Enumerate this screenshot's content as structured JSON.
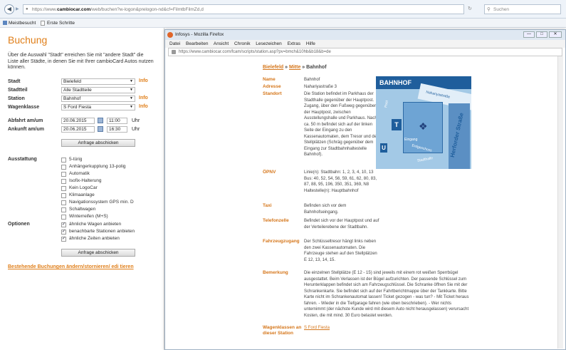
{
  "browser": {
    "url_prefix": "https://www.",
    "url_domain": "cambiocar.com",
    "url_rest": "/web/buchen?w-logon&prelogon-nd&cf=FilmtbFilmZd,d",
    "search_placeholder": "Suchen",
    "bookmarks": [
      "Meistbesucht",
      "Erste Schritte"
    ]
  },
  "booking": {
    "title": "Buchung",
    "intro": "Über die Auswahl \"Stadt\" erreichen Sie mit \"andere Stadt\" die Liste aller Städte, in denen Sie mit Ihrer cambioCard Autos nutzen können.",
    "stadt_label": "Stadt",
    "stadt_value": "Bielefeld",
    "stadtteil_label": "Stadtteil",
    "stadtteil_value": "Alle Stadtteile",
    "station_label": "Station",
    "station_value": "Bahnhof",
    "wagenklasse_label": "Wagenklasse",
    "wagenklasse_value": "S Ford Fiesta",
    "info_label": "Info",
    "abfahrt_label": "Abfahrt am/um",
    "abfahrt_date": "20.06.2015",
    "abfahrt_time": "11:00",
    "ankunft_label": "Ankunft am/um",
    "ankunft_date": "20.06.2015",
    "ankunft_time": "16:30",
    "uhr": "Uhr",
    "anfrage_button": "Anfrage abschicken",
    "ausstattung_label": "Ausstattung",
    "ausstattung": [
      "5-türig",
      "Anhängerkupplung 13-polig",
      "Automatik",
      "Isofix-Halterung",
      "Kein LogoCar",
      "Klimaanlage",
      "Navigationssystem GPS min. D",
      "Schaltwagen",
      "Winterreifen (M+S)"
    ],
    "optionen_label": "Optionen",
    "optionen": [
      "ähnliche Wagen anbieten",
      "benachbarte Stationen anbieten",
      "ähnliche Zeiten anbieten"
    ],
    "anfrage_button2": "Anfrage abschicken",
    "edit_link": "Bestehende Buchungen ändern/stornieren/ edi tieren"
  },
  "popup": {
    "title": "Infosys - Mozilla Firefox",
    "menu": [
      "Datei",
      "Bearbeiten",
      "Ansicht",
      "Chronik",
      "Lesezeichen",
      "Extras",
      "Hilfe"
    ],
    "url": "https://www.cambiocar.com/fcam/scripts/station.asp?pv=bmch&10hb&b18&b=de",
    "breadcrumb_1": "Bielefeld",
    "breadcrumb_sep": "»",
    "breadcrumb_2": "Mitte",
    "breadcrumb_3": "Bahnhof",
    "name_label": "Name",
    "name_value": "Bahnhof",
    "adresse_label": "Adresse",
    "adresse_value": "Nahariyastraße 3",
    "standort_label": "Standort",
    "standort_value": "Die Station befindet im Parkhaus der Stadthalle gegenüber der Hauptpost. Zugang, über den Fußweg gegenüber der Hauptpost, zwischen Ausstellungshalle und Parkhaus. Nach ca. 50 m befindet sich auf der linken Seite der Eingang zu den Kassenautomaten, dem Tresor und den Stellplätzen (Schräg gegenüber dem Eingang zur Stadtbahnhaltestelle Bahnhof).",
    "oepnv_label": "ÖPNV",
    "oepnv_value": "Linie(n): Stadtbahn: 1, 2, 3, 4, 10, 13 Bus: 40, 52, 54, 56, 59, 61, 62, 80, 83, 87, 88, 95, 196, 350, 351, 369, N8 Haltestelle(n): Hauptbahnhof",
    "taxi_label": "Taxi",
    "taxi_value": "Befinden sich vor dem Bahnhofseingang.",
    "telefon_label": "Telefonzelle",
    "telefon_value": "Befindet sich vor der Hauptpost und auf der Verteilerebene der Stadtbahn.",
    "fahrzeug_label": "Fahrzeugzugang",
    "fahrzeug_value": "Der Schlüsseltresor hängt links neben den zwei Kassenautomaten. Die Fahrzeuge stehen auf den Stellplätzen E 12, 13, 14, 15.",
    "bemerkung_label": "Bemerkung",
    "bemerkung_value": "Die einzelnen Stellplätze (E 12 - 15) sind jeweils mit einem rot weißen Sperrbügel ausgestattet. Beim Verlassen ist der Bügel aufzurichten. Der passende Schlüssel zum Herunterklappen befindet sich am Fahrzeugschlüssel. Die Schranke öffnen Sie mit der Schrankenkarte. Sie befindet sich auf der Fahrtberichtmappe über der Tankkarte. Bitte Karte nicht im Schrankenautomat lassen! Ticket gezogen - was tun? - Mit Ticket heraus fahren. - Wieder in die Tiefgarage fahren (wie oben beschrieben). - Wer nichts unternimmt (der nächste Kunde wird mit diesem Auto nicht herausgelassen) verursacht Kosten, die mit mind. 30 Euro belastet werden.",
    "wagenklassen_label": "Wagenklassen an dieser Station",
    "wagenklassen_value": "S Ford Fiesta",
    "map_title": "BAHNHOF",
    "map_street1": "Nahariyastraße",
    "map_street2": "Herforder Straße",
    "map_label3": "Stadthalle",
    "map_label4": "Post",
    "map_label5": "Eingang",
    "map_label6": "Erdgeschoss"
  }
}
